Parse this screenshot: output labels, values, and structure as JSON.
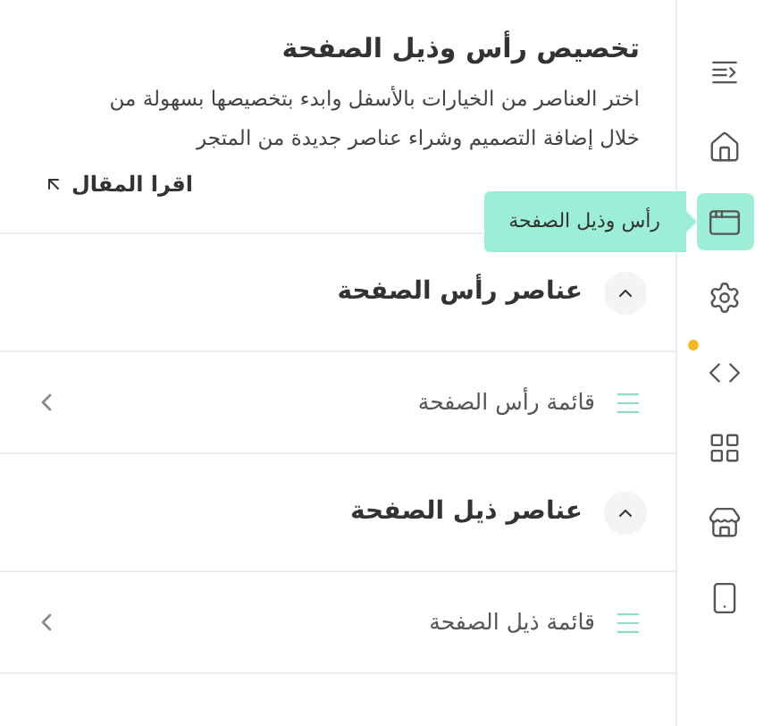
{
  "header": {
    "title": "تخصيص رأس وذيل الصفحة",
    "description": "اختر العناصر من الخيارات بالأسفل وابدء بتخصيصها بسهولة من خلال إضافة التصميم وشراء عناصر جديدة من المتجر",
    "link": "اقرا المقال"
  },
  "sections": [
    {
      "title": "عناصر رأس الصفحة",
      "expanded": true,
      "items": [
        "قائمة رأس الصفحة"
      ]
    },
    {
      "title": "عناصر ذيل الصفحة",
      "expanded": true,
      "items": [
        "قائمة ذيل الصفحة"
      ]
    }
  ],
  "sidebar": {
    "tooltip": "رأس وذيل الصفحة",
    "items": [
      {
        "kind": "collapse",
        "selected": false,
        "notification": false
      },
      {
        "kind": "home",
        "selected": false,
        "notification": false
      },
      {
        "kind": "layout",
        "selected": true,
        "notification": false
      },
      {
        "kind": "settings",
        "selected": false,
        "notification": false
      },
      {
        "kind": "code",
        "selected": false,
        "notification": true
      },
      {
        "kind": "apps",
        "selected": false,
        "notification": false
      },
      {
        "kind": "store",
        "selected": false,
        "notification": false
      },
      {
        "kind": "mobile",
        "selected": false,
        "notification": false
      }
    ]
  }
}
